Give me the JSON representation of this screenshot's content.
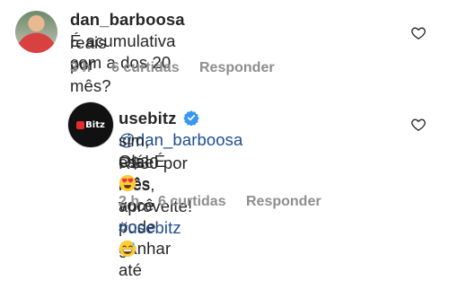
{
  "comment1": {
    "username": "dan_barboosa",
    "line1": "É acumulativa com a dos 20",
    "line2": "reais por mês?",
    "time": "3 h",
    "likes": "6 curtidas",
    "reply": "Responder"
  },
  "comment2": {
    "username": "usebitz",
    "avatar_text": "Bitz",
    "mention": "@dan_barboosa",
    "line1_rest": "Olá! É",
    "line2": "sim, esse mês você pode ganhar até",
    "line3_text": "R$30 por mês, aproveite!",
    "hashtag": "#usebitz",
    "time": "2 h",
    "likes": "6 curtidas",
    "reply": "Responder"
  },
  "icons": {
    "like": "heart-outline-icon",
    "verified": "verified-badge-icon",
    "emoji1": "grinning-sweat-emoji",
    "emoji2": "heart-eyes-emoji"
  },
  "colors": {
    "text": "#262626",
    "meta": "#8e8e8e",
    "link": "#1d4f8f",
    "verified": "#3897f0"
  }
}
